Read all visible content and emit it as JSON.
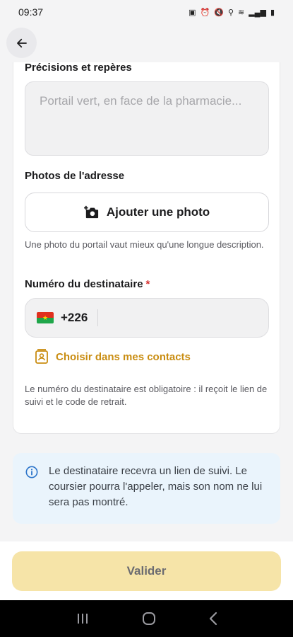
{
  "status_bar": {
    "time": "09:37"
  },
  "form": {
    "details_label": "Précisions et repères",
    "details_placeholder": "Portail vert, en face de la pharmacie...",
    "photos_label": "Photos de l'adresse",
    "add_photo_label": "Ajouter une photo",
    "photo_help": "Une photo du portail vaut mieux qu'une longue description.",
    "recipient_label": "Numéro du destinataire",
    "required_mark": "*",
    "dial_code": "+226",
    "choose_contacts_label": "Choisir dans mes contacts",
    "recipient_help": "Le numéro du destinataire est obligatoire : il reçoit le lien de suivi et le code de retrait."
  },
  "info": {
    "text": "Le destinataire recevra un lien de suivi. Le coursier pourra l'appeler, mais son nom ne lui sera pas montré."
  },
  "footer": {
    "validate_label": "Valider"
  },
  "colors": {
    "accent": "#c98d12",
    "validate_bg": "#f6e4a8",
    "info_bg": "#eaf4fc",
    "required": "#d6302f"
  },
  "icons": [
    "back-arrow-icon",
    "add-photo-icon",
    "contacts-icon",
    "info-icon",
    "flag-burkina-faso-icon"
  ]
}
